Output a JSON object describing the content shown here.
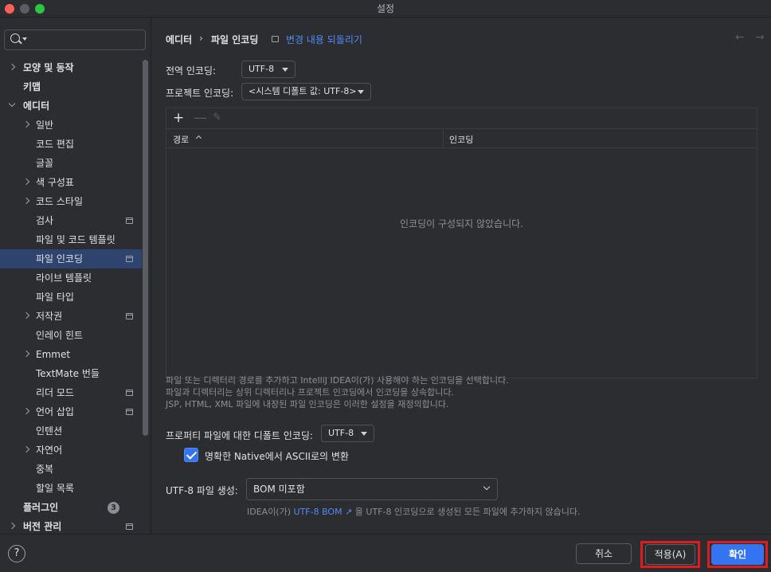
{
  "window": {
    "title": "설정"
  },
  "sidebar": {
    "search_placeholder": "",
    "items": [
      {
        "label": "모양 및 동작",
        "expand": "right",
        "indent": 0,
        "bold": true
      },
      {
        "label": "키맵",
        "expand": "",
        "indent": 0,
        "bold": true
      },
      {
        "label": "에디터",
        "expand": "down",
        "indent": 0,
        "bold": true
      },
      {
        "label": "일반",
        "expand": "right",
        "indent": 1
      },
      {
        "label": "코드 편집",
        "expand": "",
        "indent": 1
      },
      {
        "label": "글꼴",
        "expand": "",
        "indent": 1
      },
      {
        "label": "색 구성표",
        "expand": "right",
        "indent": 1
      },
      {
        "label": "코드 스타일",
        "expand": "right",
        "indent": 1
      },
      {
        "label": "검사",
        "expand": "",
        "indent": 1,
        "project": true
      },
      {
        "label": "파일 및 코드 템플릿",
        "expand": "",
        "indent": 1
      },
      {
        "label": "파일 인코딩",
        "expand": "",
        "indent": 1,
        "project": true,
        "selected": true
      },
      {
        "label": "라이브 템플릿",
        "expand": "",
        "indent": 1
      },
      {
        "label": "파일 타입",
        "expand": "",
        "indent": 1
      },
      {
        "label": "저작권",
        "expand": "right",
        "indent": 1,
        "project": true
      },
      {
        "label": "인레이 힌트",
        "expand": "",
        "indent": 1
      },
      {
        "label": "Emmet",
        "expand": "right",
        "indent": 1
      },
      {
        "label": "TextMate 번들",
        "expand": "",
        "indent": 1
      },
      {
        "label": "리더 모드",
        "expand": "",
        "indent": 1,
        "project": true
      },
      {
        "label": "언어 삽입",
        "expand": "right",
        "indent": 1,
        "project": true
      },
      {
        "label": "인텐션",
        "expand": "",
        "indent": 1
      },
      {
        "label": "자연어",
        "expand": "right",
        "indent": 1
      },
      {
        "label": "중복",
        "expand": "",
        "indent": 1
      },
      {
        "label": "할일 목록",
        "expand": "",
        "indent": 1
      },
      {
        "label": "플러그인",
        "expand": "",
        "indent": 0,
        "bold": true,
        "badge": "3"
      },
      {
        "label": "버전 관리",
        "expand": "right",
        "indent": 0,
        "bold": true,
        "project": true
      }
    ]
  },
  "header": {
    "crumb1": "에디터",
    "separator": "›",
    "crumb2": "파일 인코딩",
    "revert_link": "변경 내용 되돌리기",
    "back": "←",
    "forward": "→"
  },
  "settings": {
    "global_encoding_label": "전역 인코딩:",
    "global_encoding_value": "UTF-8",
    "project_encoding_label": "프로젝트 인코딩:",
    "project_encoding_value": "<시스템 디폴트 값: UTF-8>",
    "table": {
      "add": "+",
      "remove": "—",
      "edit": "✎",
      "col_path": "경로",
      "col_encoding": "인코딩",
      "empty_message": "인코딩이 구성되지 않았습니다."
    },
    "hint_lines": [
      "파일 또는 디렉터리 경로를 추가하고 IntelliJ IDEA이(가) 사용해야 하는 인코딩을 선택합니다.",
      "파일과 디렉터리는 상위 디렉터리나 프로젝트 인코딩에서 인코딩을 상속합니다.",
      "JSP, HTML, XML 파일에 내장된 파일 인코딩은 이러한 설정을 재정의합니다."
    ],
    "properties_label": "프로퍼티 파일에 대한 디폴트 인코딩:",
    "properties_value": "UTF-8",
    "native_ascii_label": "명확한 Native에서 ASCII로의 변환",
    "native_ascii_checked": true,
    "bom_label": "UTF-8 파일 생성:",
    "bom_value": "BOM 미포함",
    "bom_hint_prefix": "IDEA이(가) ",
    "bom_hint_link": "UTF-8 BOM ↗",
    "bom_hint_suffix": " 을 UTF-8 인코딩으로 생성된 모든 파일에 추가하지 않습니다."
  },
  "footer": {
    "help": "?",
    "cancel": "취소",
    "apply": "적용(A)",
    "ok": "확인"
  },
  "colors": {
    "accent": "#3574f0",
    "link": "#548af7",
    "highlight_box": "#e01b1b"
  }
}
